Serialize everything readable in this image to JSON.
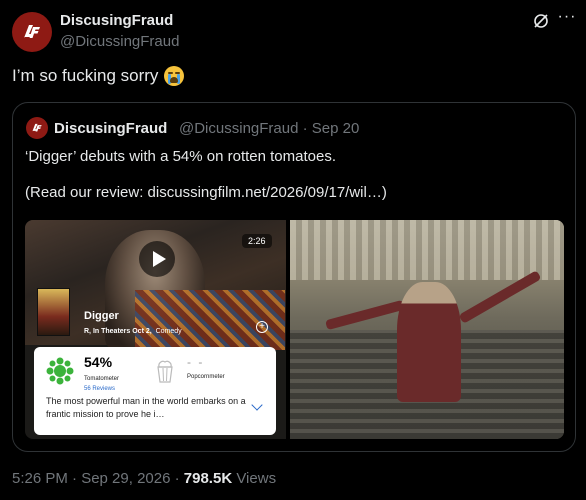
{
  "author": {
    "name": "DiscusingFraud",
    "handle": "@DicussingFraud"
  },
  "tweet": {
    "text": "I’m so fucking sorry",
    "emoji": "loudly-crying-face"
  },
  "quoted": {
    "name": "DiscusingFraud",
    "handle_date": "@DicussingFraud · Sep 20",
    "line1": "‘Digger’ debuts with a 54% on rotten tomatoes.",
    "line2": "(Read our review: discussingfilm.net/2026/09/17/wil…)",
    "video": {
      "duration": "2:26",
      "movie_title": "Digger",
      "meta_bold": "R, In Theaters Oct 2,",
      "meta_genre": "Comedy"
    },
    "rt_card": {
      "tomatometer_score": "54%",
      "tomatometer_label": "Tomatometer",
      "reviews": "56 Reviews",
      "popcornmeter_score": "- -",
      "popcornmeter_label": "Popcornmeter",
      "synopsis": "The most powerful man in the world embarks on a frantic mission to prove he i…"
    }
  },
  "footer": {
    "time": "5:26 PM · Sep 29, 2026 · ",
    "views_num": "798.5K",
    "views_label": " Views"
  },
  "colors": {
    "background": "#000000",
    "text": "#e7e9ea",
    "muted": "#71767b",
    "border": "#2f3336",
    "brand": "#8e1a14",
    "rt_green": "#3bb33b"
  }
}
